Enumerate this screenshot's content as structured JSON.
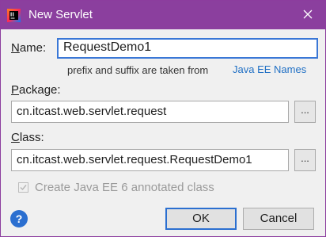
{
  "window": {
    "title": "New Servlet",
    "accent": "#8b3f9e"
  },
  "form": {
    "name": {
      "label_key": "N",
      "label_rest": "ame:",
      "value": "RequestDemo1"
    },
    "hint": "prefix and suffix are taken from",
    "hint_link": "Java EE Names",
    "package": {
      "label_key": "P",
      "label_rest": "ackage:",
      "value": "cn.itcast.web.servlet.request"
    },
    "class": {
      "label_key": "C",
      "label_rest": "lass:",
      "value": "cn.itcast.web.servlet.request.RequestDemo1"
    },
    "browse_label": "...",
    "annotated_checkbox": {
      "label": "Create Java EE 6 annotated class",
      "checked": true,
      "enabled": false
    }
  },
  "buttons": {
    "help": "?",
    "ok": "OK",
    "cancel": "Cancel"
  },
  "icons": {
    "app": "intellij-idea-icon",
    "close": "close-icon",
    "help": "help-icon"
  }
}
